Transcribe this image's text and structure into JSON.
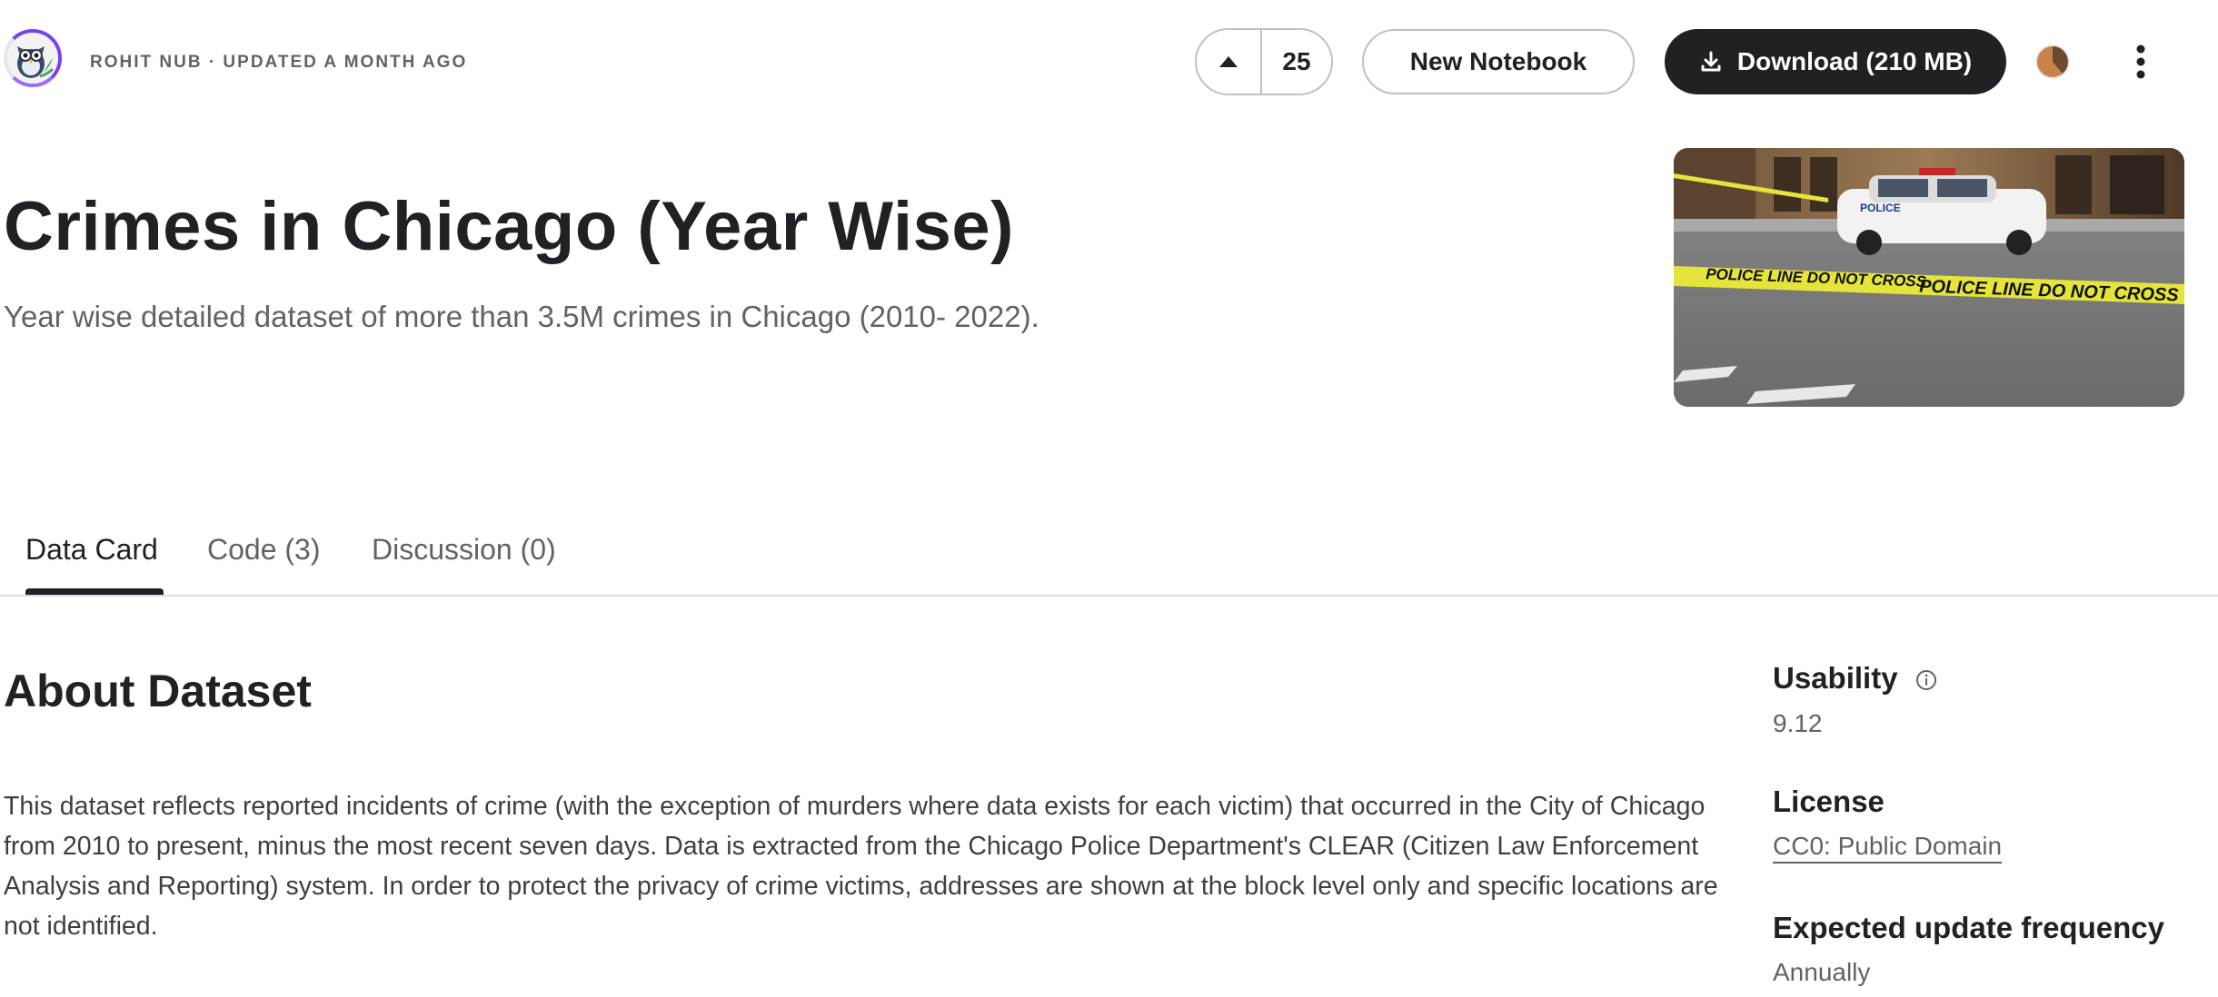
{
  "header": {
    "author_meta": "ROHIT NUB · UPDATED A MONTH AGO",
    "vote_count": "25",
    "new_notebook_label": "New Notebook",
    "download_label": "Download (210 MB)",
    "icons": {
      "upvote": "caret-up-icon",
      "download": "download-icon",
      "more": "more-vertical-icon"
    }
  },
  "hero": {
    "title": "Crimes in Chicago (Year Wise)",
    "subtitle": "Year wise detailed dataset of more than 3.5M crimes in Chicago (2010- 2022).",
    "image_tape_text": "POLICE LINE DO NOT CROSS",
    "image_car_text": "POLICE"
  },
  "tabs": [
    {
      "label": "Data Card",
      "active": true
    },
    {
      "label": "Code (3)",
      "active": false
    },
    {
      "label": "Discussion (0)",
      "active": false
    }
  ],
  "about": {
    "title": "About Dataset",
    "body": "This dataset reflects reported incidents of crime (with the exception of murders where data exists for each victim) that occurred in the City of Chicago from 2010 to present, minus the most recent seven days. Data is extracted from the Chicago Police Department's CLEAR (Citizen Law Enforcement Analysis and Reporting) system. In order to protect the privacy of crime victims, addresses are shown at the block level only and specific locations are not identified."
  },
  "sidebar": {
    "usability_label": "Usability",
    "usability_value": "9.12",
    "license_label": "License",
    "license_value": "CC0: Public Domain",
    "frequency_label": "Expected update frequency",
    "frequency_value": "Annually"
  },
  "colors": {
    "text_primary": "#202124",
    "text_secondary": "#5f6368",
    "dark_button": "#202124",
    "border": "#bdc1c6",
    "tape_yellow": "#e4e43a"
  }
}
